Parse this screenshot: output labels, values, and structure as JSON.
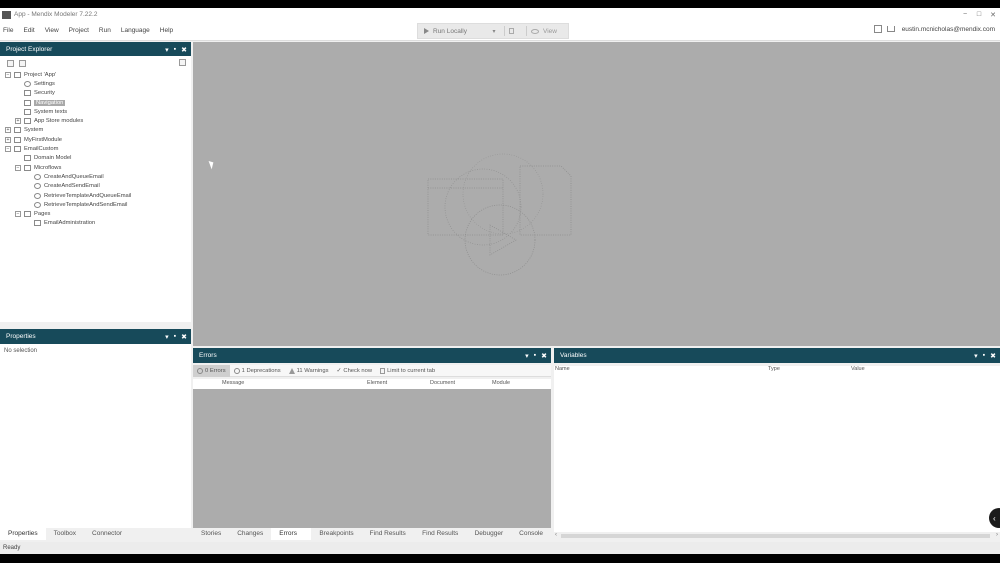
{
  "window": {
    "title": "App - Mendix Modeler 7.22.2",
    "minimize": "−",
    "maximize": "□",
    "close": "✕"
  },
  "menu": [
    "File",
    "Edit",
    "View",
    "Project",
    "Run",
    "Language",
    "Help"
  ],
  "run": {
    "run_label": "Run Locally",
    "view_label": "View"
  },
  "account": {
    "email": "eustin.mcnicholas@mendix.com"
  },
  "project_explorer": {
    "title": "Project Explorer",
    "tree": [
      {
        "label": "Project 'App'",
        "indent": 0,
        "expander": "−",
        "icon": "project-icon"
      },
      {
        "label": "Settings",
        "indent": 1,
        "icon": "gear-icon"
      },
      {
        "label": "Security",
        "indent": 1,
        "icon": "key-icon"
      },
      {
        "label": "Navigation",
        "indent": 1,
        "icon": "home-icon",
        "selected": true
      },
      {
        "label": "System texts",
        "indent": 1,
        "icon": "texts-icon"
      },
      {
        "label": "App Store modules",
        "indent": 1,
        "expander": "+",
        "icon": "store-icon"
      },
      {
        "label": "System",
        "indent": 0,
        "expander": "+",
        "icon": "module-icon"
      },
      {
        "label": "MyFirstModule",
        "indent": 0,
        "expander": "+",
        "icon": "module-icon"
      },
      {
        "label": "EmailCustom",
        "indent": 0,
        "expander": "−",
        "icon": "module-icon"
      },
      {
        "label": "Domain Model",
        "indent": 1,
        "icon": "domain-model-icon"
      },
      {
        "label": "Microflows",
        "indent": 1,
        "expander": "−",
        "icon": "folder-icon"
      },
      {
        "label": "CreateAndQueueEmail",
        "indent": 2,
        "icon": "microflow-icon"
      },
      {
        "label": "CreateAndSendEmail",
        "indent": 2,
        "icon": "microflow-icon"
      },
      {
        "label": "RetrieveTemplateAndQueueEmail",
        "indent": 2,
        "icon": "microflow-icon"
      },
      {
        "label": "RetrieveTemplateAndSendEmail",
        "indent": 2,
        "icon": "microflow-icon"
      },
      {
        "label": "Pages",
        "indent": 1,
        "expander": "−",
        "icon": "folder-icon"
      },
      {
        "label": "EmailAdministration",
        "indent": 2,
        "icon": "page-icon"
      }
    ]
  },
  "properties": {
    "title": "Properties",
    "empty_text": "No selection"
  },
  "left_tabs": [
    "Properties",
    "Toolbox",
    "Connector"
  ],
  "errors": {
    "title": "Errors",
    "toolbar": {
      "errors": "0 Errors",
      "deprecations": "1 Deprecations",
      "warnings": "11 Warnings",
      "check_now": "Check now",
      "limit": "Limit to current tab"
    },
    "columns": [
      "Message",
      "Element",
      "Document",
      "Module"
    ]
  },
  "variables": {
    "title": "Variables",
    "columns": [
      "Name",
      "Type",
      "Value"
    ]
  },
  "bottom_tabs": [
    "Stories",
    "Changes",
    "Errors (0)",
    "Breakpoints",
    "Find Results 1",
    "Find Results 2",
    "Debugger",
    "Console"
  ],
  "panel_controls": {
    "pin": "▾",
    "float": "▪",
    "close": "✖"
  },
  "status": "Ready",
  "colors": {
    "panel_header": "#174a5a",
    "editor_bg": "#acacac"
  }
}
